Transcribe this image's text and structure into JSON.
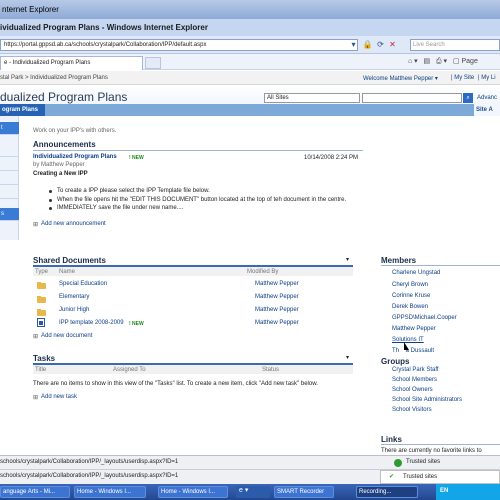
{
  "window": {
    "title": "nternet Explorer"
  },
  "ie": {
    "page_title": "ividualized Program Plans - Windows Internet Explorer",
    "url": "https://portal.gppsd.ab.ca/schools/crystalpark/Collaboration/IPP/default.aspx",
    "search_placeholder": "Live Search",
    "tab_label": "e - Individualized Program Plans",
    "page_menu": "Page",
    "status_url": "schools/crystalpark/Collaboration/IPP/_layouts/userdisp.aspx?ID=1",
    "trusted_sites": "Trusted sites"
  },
  "sharepoint": {
    "breadcrumb": "stal Park > Individualized Program Plans",
    "welcome": "Welcome Matthew Pepper ▾",
    "my_site": "| My Site",
    "my_links": "| My Li",
    "site_title": "dualized Program Plans",
    "search_scope": "All Sites",
    "advanced": "Advanc",
    "nav_tab": "ogram Plans",
    "site_actions": "Site A",
    "description": "Work on your IPP's with others.",
    "quicklaunch": [
      "t",
      "",
      "",
      "",
      "",
      "s"
    ]
  },
  "announcements": {
    "title": "Announcements",
    "item_title": "Individualized Program Plans",
    "new_badge": "! NEW",
    "date": "10/14/2008 2:24 PM",
    "by": "by Matthew Pepper",
    "subtitle": "Creating a New IPP",
    "bullets": [
      "To create a IPP please select the IPP Template file below.",
      "When the file opens hit the \"EDIT THIS DOCUMENT\" button located at the top of teh document in the centre.",
      "IMMEDIATELY save the file under new name...."
    ],
    "add_link": "Add new announcement"
  },
  "shared_documents": {
    "title": "Shared Documents",
    "col_type": "Type",
    "col_name": "Name",
    "col_modified": "Modified By",
    "rows": [
      {
        "name": "Special Education",
        "modified_by": "Matthew Pepper",
        "is_new": false
      },
      {
        "name": "Elementary",
        "modified_by": "Matthew Pepper",
        "is_new": false
      },
      {
        "name": "Junior High",
        "modified_by": "Matthew Pepper",
        "is_new": false
      },
      {
        "name": "IPP template 2008-2009",
        "modified_by": "Matthew Pepper",
        "is_new": true
      }
    ],
    "add_link": "Add new document"
  },
  "tasks": {
    "title": "Tasks",
    "col_title": "Title",
    "col_assigned": "Assigned To",
    "col_status": "Status",
    "empty_text": "There are no items to show in this view of the \"Tasks\" list. To create a new item, click \"Add new task\" below.",
    "add_link": "Add new task"
  },
  "members": {
    "title": "Members",
    "people": [
      "Charlene Ungstad",
      "Cheryl Brown",
      "Corinne Kruse",
      "Derek Bowen",
      "GPPSD\\Michael.Cooper",
      "Matthew Pepper",
      "Solutions IT",
      "Th    a Dussault"
    ],
    "groups_title": "Groups",
    "groups": [
      "Crystal Park Staff",
      "School Members",
      "School Owners",
      "School Site Administrators",
      "School Visitors"
    ]
  },
  "links": {
    "title": "Links",
    "empty_text": "There are currently no favorite links to"
  },
  "taskbar": {
    "buttons": [
      "anguage Arts - Mi...",
      "Home - Windows I...",
      "Home - Windows I...",
      "SMART Recorder",
      "Recording..."
    ],
    "lang": "EN"
  }
}
